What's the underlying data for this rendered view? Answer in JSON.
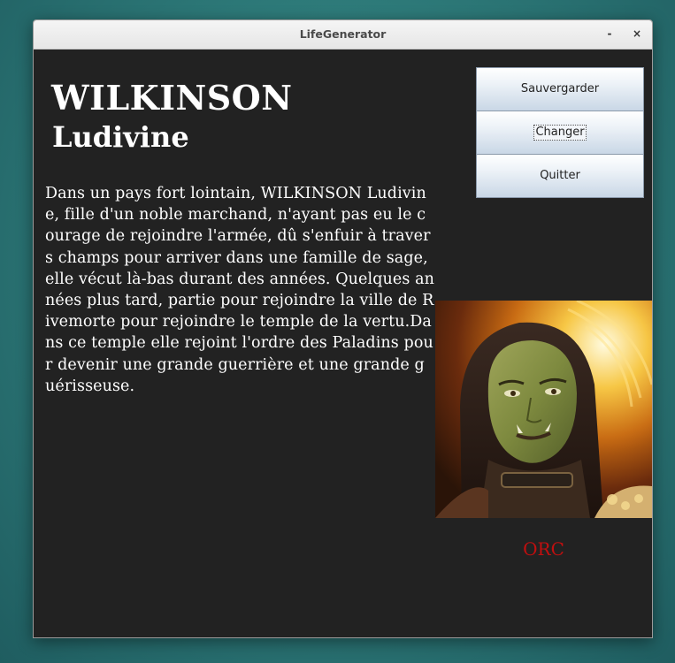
{
  "window": {
    "title": "LifeGenerator",
    "minimize_label": "-",
    "close_label": "×"
  },
  "character": {
    "last_name": "WILKINSON",
    "first_name": "Ludivine",
    "story": "Dans un pays fort lointain, WILKINSON Ludivine, fille d'un noble marchand, n'ayant pas eu le courage de rejoindre l'armée, dû s'enfuir à travers champs pour arriver dans une famille de sage, elle vécut là-bas durant des années. Quelques années plus tard, partie pour rejoindre la ville de Rivemorte pour rejoindre le temple de la vertu.Dans ce temple elle rejoint l'ordre des Paladins pour devenir une grande guerrière et une grande guérisseuse.",
    "race": "ORC"
  },
  "buttons": {
    "save": "Sauvergarder",
    "change": "Changer",
    "quit": "Quitter"
  },
  "colors": {
    "background": "#222222",
    "race_text": "#c10f0f",
    "text": "#ffffff"
  },
  "icons": {
    "minimize": "minimize-icon",
    "close": "close-icon",
    "portrait": "orc-portrait-image"
  }
}
